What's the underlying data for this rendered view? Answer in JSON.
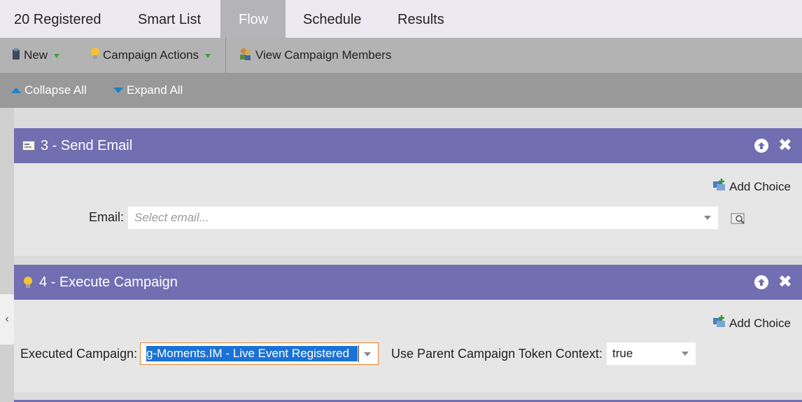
{
  "tabs": [
    {
      "label": "20 Registered"
    },
    {
      "label": "Smart List"
    },
    {
      "label": "Flow"
    },
    {
      "label": "Schedule"
    },
    {
      "label": "Results"
    }
  ],
  "active_tab": "Flow",
  "toolbar": {
    "new_label": "New",
    "campaign_actions_label": "Campaign Actions",
    "view_members_label": "View Campaign Members"
  },
  "subbar": {
    "collapse_label": "Collapse All",
    "expand_label": "Expand All"
  },
  "steps": [
    {
      "title": "3 - Send Email",
      "icon": "email-icon",
      "add_choice_label": "Add Choice",
      "field_label": "Email:",
      "placeholder": "Select email..."
    },
    {
      "title": "4 - Execute Campaign",
      "icon": "lightbulb-icon",
      "add_choice_label": "Add Choice",
      "executed_label": "Executed Campaign:",
      "executed_value": "g-Moments.IM - Live Event Registered",
      "token_label": "Use Parent Campaign Token Context:",
      "token_value": "true"
    }
  ],
  "colors": {
    "step_header": "#726eb2",
    "active_tab": "#b3b3b8",
    "selection": "#1b72d6",
    "focus_border": "#e8852d"
  }
}
